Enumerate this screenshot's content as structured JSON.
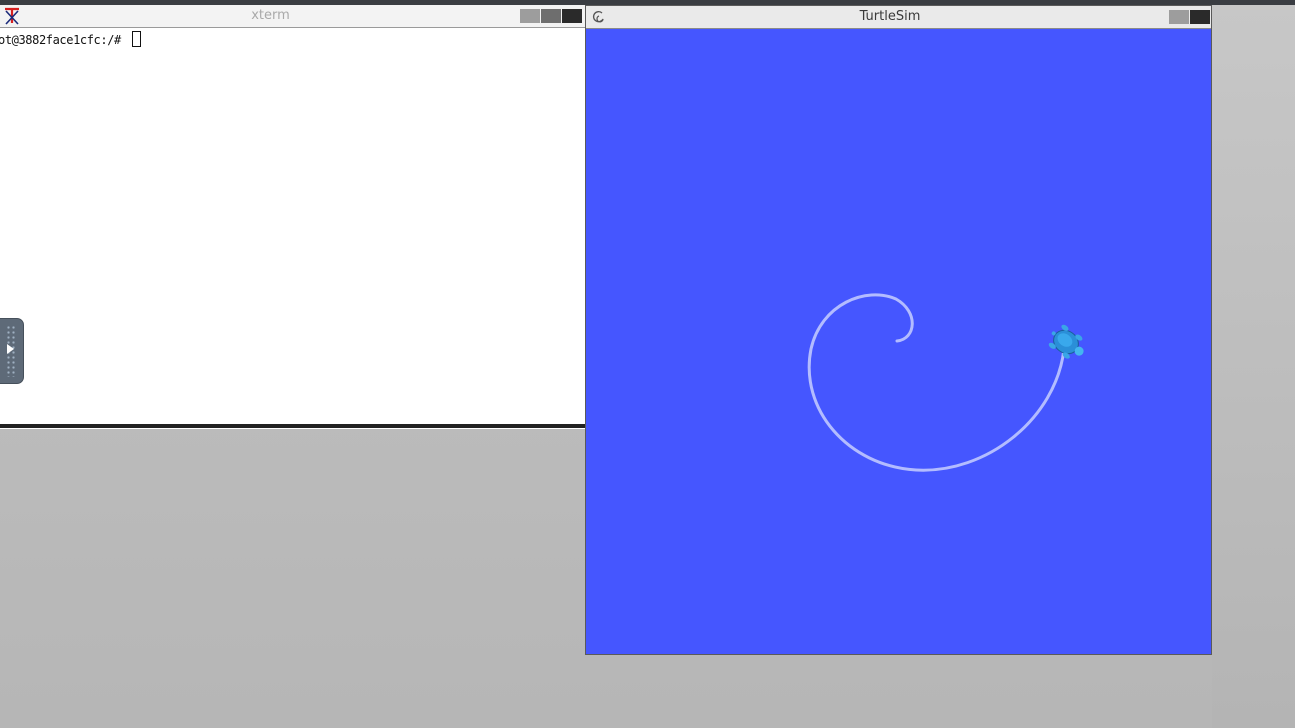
{
  "desktop": {
    "background_color": "#bcbcbc"
  },
  "xterm": {
    "title": "xterm",
    "prompt": "ot@3882face1cfc:/# ",
    "colors": {
      "background": "#ffffff",
      "text": "#111111",
      "title_text": "#a9a9a9"
    },
    "logo_icon": "x-logo-icon"
  },
  "turtlesim": {
    "title": "TurtleSim",
    "background_color": "#4556ff",
    "trail_color": "#b3bcff",
    "turtle_icon": "turtle-icon"
  },
  "side_panel": {
    "icon": "play-icon"
  }
}
